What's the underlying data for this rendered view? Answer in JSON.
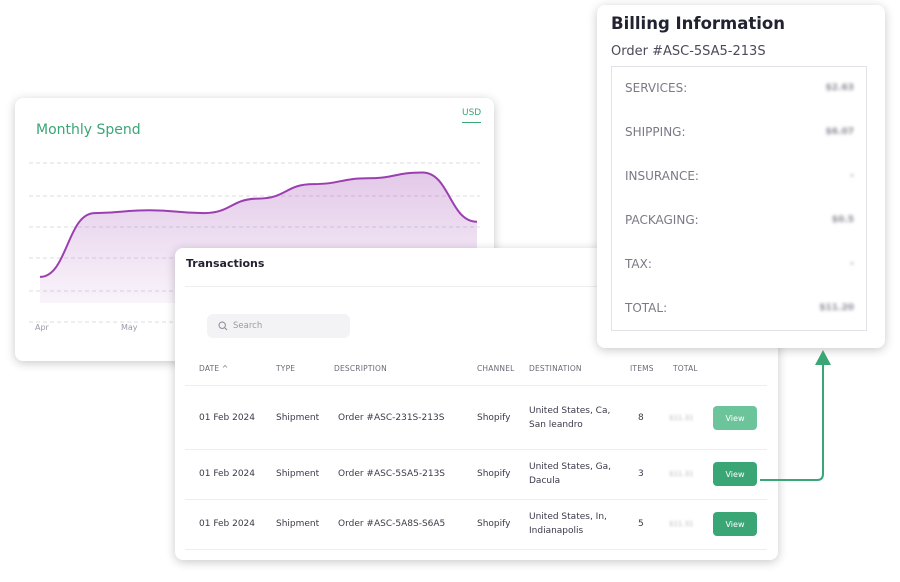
{
  "chart_card": {
    "title": "Monthly Spend",
    "currency": "USD",
    "months": [
      "Apr",
      "May"
    ],
    "accent_color": "#3aa676",
    "line_color": "#9b3fb0"
  },
  "chart_data": {
    "type": "area",
    "title": "Monthly Spend",
    "x": [
      "Apr",
      "May"
    ],
    "series": [
      {
        "values": [
          0.18,
          0.62,
          0.64,
          0.62,
          0.72,
          0.82,
          0.86,
          0.9,
          0.56
        ]
      }
    ],
    "grid": true
  },
  "transactions": {
    "title": "Transactions",
    "search_placeholder": "Search",
    "headers": [
      "DATE ^",
      "TYPE",
      "DESCRIPTION",
      "CHANNEL",
      "DESTINATION",
      "ITEMS",
      "TOTAL"
    ],
    "rows": [
      {
        "date": "01 Feb 2024",
        "type": "Shipment",
        "description": "Order #ASC-231S-213S",
        "channel": "Shopify",
        "dest1": "United States, Ca,",
        "dest2": "San leandro",
        "items": "8",
        "total": "$11.31",
        "action": "View"
      },
      {
        "date": "01 Feb 2024",
        "type": "Shipment",
        "description": "Order #ASC-5SA5-213S",
        "channel": "Shopify",
        "dest1": "United States, Ga,",
        "dest2": "Dacula",
        "items": "3",
        "total": "$11.31",
        "action": "View"
      },
      {
        "date": "01 Feb 2024",
        "type": "Shipment",
        "description": "Order #ASC-5A8S-S6A5",
        "channel": "Shopify",
        "dest1": "United States, In,",
        "dest2": "Indianapolis",
        "items": "5",
        "total": "$11.31",
        "action": "View"
      }
    ],
    "button_colors": [
      "#6cc49b",
      "#3aa676",
      "#3aa676"
    ]
  },
  "billing": {
    "title": "Billing Information",
    "order": "Order #ASC-5SA5-213S",
    "lines": [
      {
        "label": "SERVICES:",
        "value": "$2.63"
      },
      {
        "label": "SHIPPING:",
        "value": "$6.07"
      },
      {
        "label": "INSURANCE:",
        "value": "-"
      },
      {
        "label": "PACKAGING:",
        "value": "$0.5"
      },
      {
        "label": "TAX:",
        "value": "-"
      },
      {
        "label": "TOTAL:",
        "value": "$11.20"
      }
    ]
  }
}
